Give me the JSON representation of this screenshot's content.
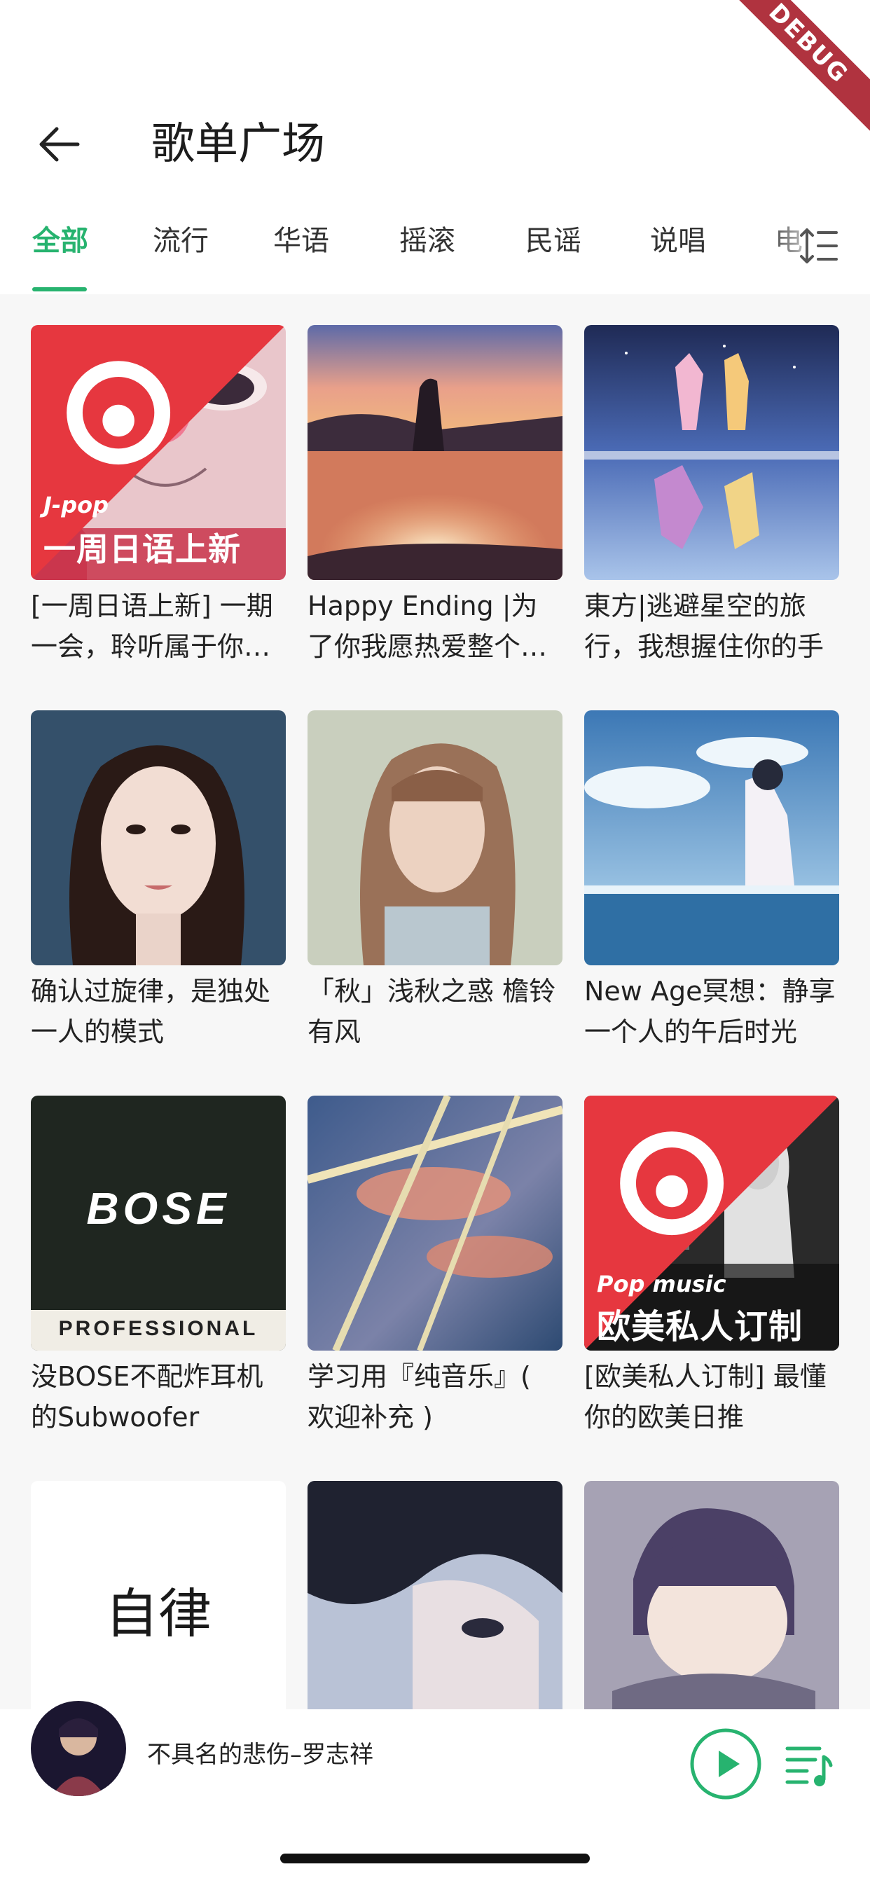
{
  "debug_label": "DEBUG",
  "appbar": {
    "title": "歌单广场"
  },
  "tabs": [
    {
      "label": "全部",
      "active": true
    },
    {
      "label": "流行",
      "active": false
    },
    {
      "label": "华语",
      "active": false
    },
    {
      "label": "摇滚",
      "active": false
    },
    {
      "label": "民谣",
      "active": false
    },
    {
      "label": "说唱",
      "active": false
    },
    {
      "label": "电",
      "active": false
    }
  ],
  "accent_color": "#27b36f",
  "playlists": [
    {
      "title": "[一周日语上新] 一期一会，聆听属于你…",
      "official": true,
      "cover_tag": "J-pop",
      "cover_text": "一周日语上新"
    },
    {
      "title": "Happy Ending |为了你我愿热爱整个世界"
    },
    {
      "title": "東方|逃避星空的旅行，我想握住你的手"
    },
    {
      "title": "确认过旋律，是独处一人的模式"
    },
    {
      "title": "「秋」浅秋之惑 檐铃有风"
    },
    {
      "title": "New Age冥想：静享一个人的午后时光"
    },
    {
      "title": "没BOSE不配炸耳机的Subwoofer",
      "cover_brand": "BOSE",
      "cover_sub": "PROFESSIONAL"
    },
    {
      "title": "学习用『纯音乐』( 欢迎补充 )"
    },
    {
      "title": "[欧美私人订制] 最懂你的欧美日推",
      "official": true,
      "cover_tag": "Pop music",
      "cover_text": "欧美私人订制"
    },
    {
      "title": "",
      "cover_text": "自律"
    },
    {
      "title": ""
    },
    {
      "title": ""
    }
  ],
  "player": {
    "now_playing": "不具名的悲伤–罗志祥"
  }
}
